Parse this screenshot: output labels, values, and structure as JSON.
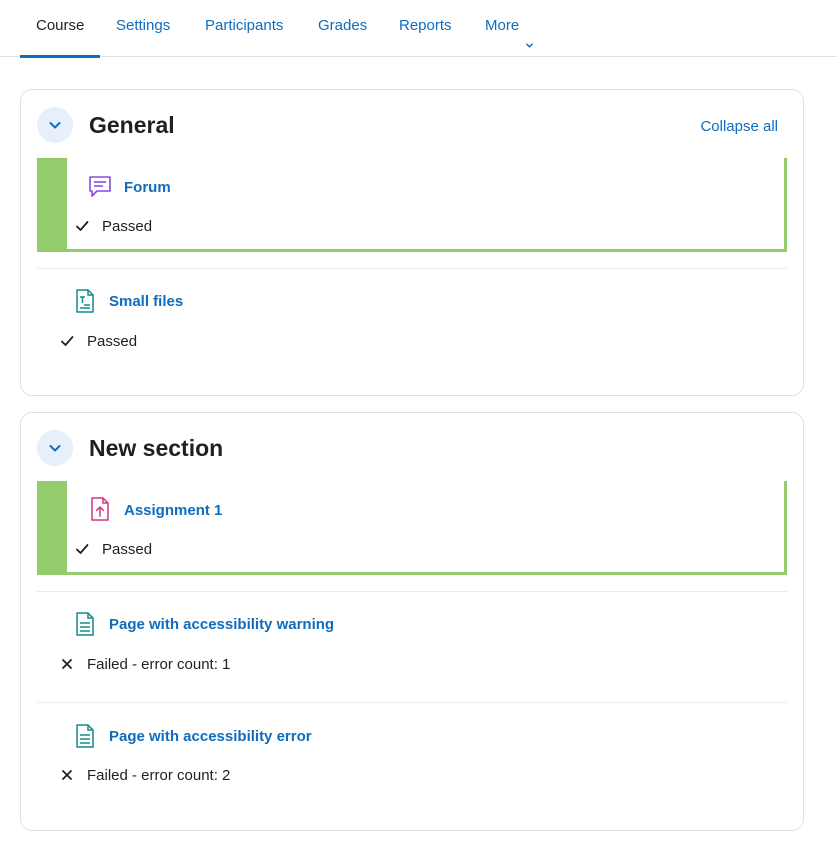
{
  "nav": {
    "tabs": [
      {
        "label": "Course",
        "active": true
      },
      {
        "label": "Settings"
      },
      {
        "label": "Participants"
      },
      {
        "label": "Grades"
      },
      {
        "label": "Reports"
      },
      {
        "label": "More"
      }
    ],
    "more_icon": "chevron-down-icon"
  },
  "colors": {
    "link": "#0f6cbf",
    "completion_highlight": "#94cb6c",
    "forum_icon": "#8a4bd6",
    "file_icon": "#158a8a",
    "assignment_icon": "#d63384",
    "toggle_bg": "#e7f0fa"
  },
  "collapse_all": "Collapse all",
  "sections": [
    {
      "title": "General",
      "activities": [
        {
          "name": "Forum",
          "icon": "forum-icon",
          "status_icon": "check-icon",
          "status": "Passed",
          "highlighted": true
        },
        {
          "name": "Small files",
          "icon": "file-icon",
          "status_icon": "check-icon",
          "status": "Passed",
          "highlighted": false
        }
      ]
    },
    {
      "title": "New section",
      "activities": [
        {
          "name": "Assignment 1",
          "icon": "assignment-icon",
          "status_icon": "check-icon",
          "status": "Passed",
          "highlighted": true
        },
        {
          "name": "Page with accessibility warning",
          "icon": "page-icon",
          "status_icon": "cross-icon",
          "status": "Failed - error count: 1",
          "highlighted": false
        },
        {
          "name": "Page with accessibility error",
          "icon": "page-icon",
          "status_icon": "cross-icon",
          "status": "Failed - error count: 2",
          "highlighted": false
        }
      ]
    }
  ]
}
